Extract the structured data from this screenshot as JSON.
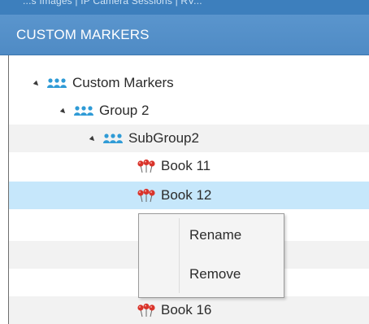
{
  "window": {
    "top_strip_text": "...s Images  |  IP Camera Sessions  |  RV..."
  },
  "panel": {
    "title": "CUSTOM MARKERS"
  },
  "tree": {
    "root": {
      "label": "Custom Markers",
      "icon": "group-icon"
    },
    "group2": {
      "label": "Group 2",
      "icon": "group-icon"
    },
    "subgroup2": {
      "label": "SubGroup2",
      "icon": "group-icon"
    },
    "items": [
      {
        "label": "Book 11",
        "icon": "map-marker-icon"
      },
      {
        "label": "Book 12",
        "icon": "map-marker-icon",
        "selected": true
      },
      {
        "label": "Book 16",
        "icon": "map-marker-icon"
      }
    ]
  },
  "context_menu": {
    "items": [
      {
        "label": "Rename"
      },
      {
        "label": "Remove"
      }
    ]
  },
  "colors": {
    "header": "#4f8bc5",
    "selected_row": "#c6e7fb",
    "stripe_row": "#f2f2f2",
    "group_icon": "#2f9bd6",
    "marker_icon": "#d9342b"
  }
}
